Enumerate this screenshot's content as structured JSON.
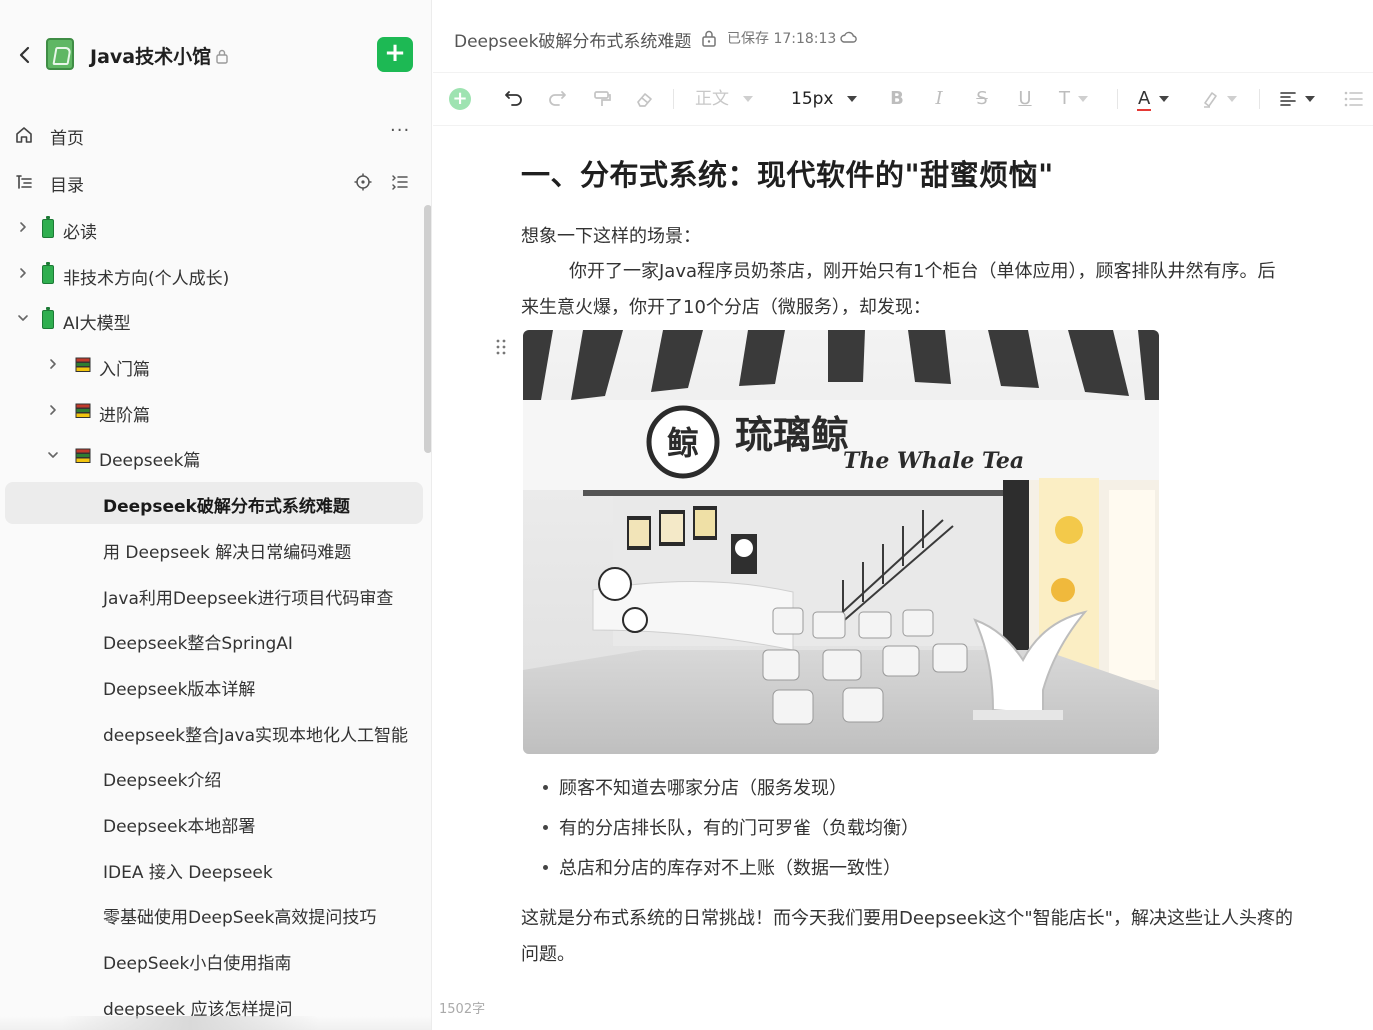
{
  "sidebar": {
    "book_title": "Java技术小馆",
    "nav": {
      "home_label": "首页",
      "more_label": "···",
      "toc_label": "目录"
    },
    "tree": [
      {
        "label": "必读",
        "icon": "battery-icon",
        "level": 0,
        "expanded": false,
        "active": false
      },
      {
        "label": "非技术方向(个人成长)",
        "icon": "battery-icon",
        "level": 0,
        "expanded": false,
        "active": false
      },
      {
        "label": "AI大模型",
        "icon": "battery-icon",
        "level": 0,
        "expanded": true,
        "active": false
      },
      {
        "label": "入门篇",
        "icon": "books-icon",
        "level": 1,
        "expanded": false,
        "active": false
      },
      {
        "label": "进阶篇",
        "icon": "books-icon",
        "level": 1,
        "expanded": false,
        "active": false
      },
      {
        "label": "Deepseek篇",
        "icon": "books-icon",
        "level": 1,
        "expanded": true,
        "active": false
      },
      {
        "label": "Deepseek破解分布式系统难题",
        "level": 2,
        "active": true
      },
      {
        "label": "用 Deepseek 解决日常编码难题",
        "level": 2,
        "active": false
      },
      {
        "label": "Java利用Deepseek进行项目代码审查",
        "level": 2,
        "active": false
      },
      {
        "label": "Deepseek整合SpringAI",
        "level": 2,
        "active": false
      },
      {
        "label": "Deepseek版本详解",
        "level": 2,
        "active": false
      },
      {
        "label": "deepseek整合Java实现本地化人工智能",
        "level": 2,
        "active": false
      },
      {
        "label": "Deepseek介绍",
        "level": 2,
        "active": false
      },
      {
        "label": "Deepseek本地部署",
        "level": 2,
        "active": false
      },
      {
        "label": "IDEA 接入 Deepseek",
        "level": 2,
        "active": false
      },
      {
        "label": "零基础使用DeepSeek高效提问技巧",
        "level": 2,
        "active": false
      },
      {
        "label": "DeepSeek小白使用指南",
        "level": 2,
        "active": false
      },
      {
        "label": "deepseek 应该怎样提问",
        "level": 2,
        "active": false
      }
    ]
  },
  "doc": {
    "title": "Deepseek破解分布式系统难题",
    "saved_status": "已保存 17:18:13"
  },
  "toolbar": {
    "paragraph_style": "正文",
    "font_size": "15px",
    "text_color": "#e53935"
  },
  "editor": {
    "heading": "一、分布式系统：现代软件的\"甜蜜烦恼\"",
    "intro": "想象一下这样的场景：",
    "para_line1": "你开了一家Java程序员奶茶店，刚开始只有1个柜台（单体应用），顾客排队井然有序。后",
    "para_line2": "来生意火爆，你开了10个分店（微服务），却发现：",
    "image": {
      "sign_cn": "琉璃鲸",
      "sign_en": "The Whale Tea",
      "logo_char": "鲸"
    },
    "bullets": [
      "顾客不知道去哪家分店（服务发现）",
      "有的分店排长队，有的门可罗雀（负载均衡）",
      "总店和分店的库存对不上账（数据一致性）"
    ],
    "conclusion_line1": "这就是分布式系统的日常挑战！而今天我们要用Deepseek这个\"智能店长\"，解决这些让人头疼的",
    "conclusion_line2": "问题。"
  },
  "footer": {
    "word_count": "1502字"
  }
}
